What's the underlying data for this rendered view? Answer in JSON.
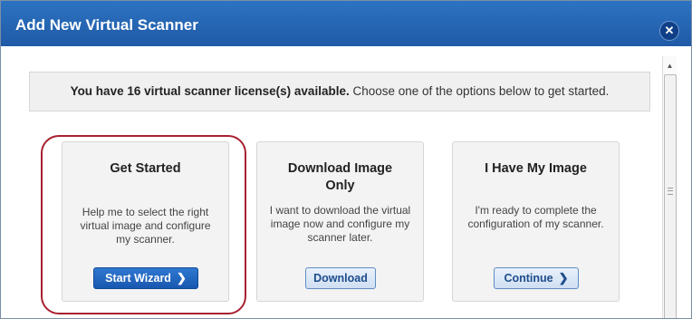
{
  "dialog": {
    "title": "Add New Virtual Scanner",
    "close_icon": "close-icon"
  },
  "license_bar": {
    "bold_text": "You have 16 virtual scanner license(s) available.",
    "rest_text": " Choose one of the options below to get started."
  },
  "cards": [
    {
      "title": "Get Started",
      "description": "Help me to select the right virtual image and configure my scanner.",
      "button_label": "Start Wizard",
      "button_icon": "chevron-right-icon",
      "highlighted": true
    },
    {
      "title": "Download Image Only",
      "description": "I want to download the virtual image now and configure my scanner later.",
      "button_label": "Download"
    },
    {
      "title": "I Have My Image",
      "description": "I'm ready to complete the configuration of my scanner.",
      "button_label": "Continue",
      "button_icon": "chevron-right-icon"
    }
  ],
  "colors": {
    "title_bar": "#1f5aa6",
    "primary_button": "#1857b0",
    "highlight_ring": "#a82030"
  }
}
